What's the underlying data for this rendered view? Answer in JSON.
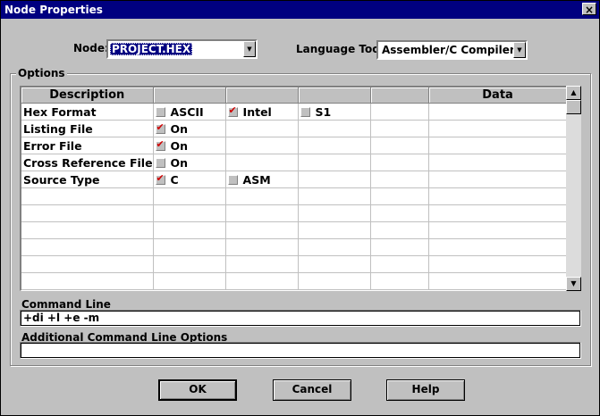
{
  "window": {
    "title": "Node Properties",
    "close_glyph": "×"
  },
  "node": {
    "label": "Node:",
    "value": "PROJECT.HEX"
  },
  "language_tool": {
    "label": "Language Tool:",
    "value": "Assembler/C Compiler"
  },
  "options": {
    "group_label": "Options",
    "headers": [
      "Description",
      "",
      "",
      "",
      "",
      "Data"
    ],
    "rows": [
      {
        "desc": "Hex Format",
        "c1": {
          "checked": false,
          "label": "ASCII"
        },
        "c2": {
          "checked": true,
          "label": "Intel"
        },
        "c3": {
          "checked": false,
          "label": "S1"
        }
      },
      {
        "desc": "Listing File",
        "c1": {
          "checked": true,
          "label": "On"
        }
      },
      {
        "desc": "Error File",
        "c1": {
          "checked": true,
          "label": "On"
        }
      },
      {
        "desc": "Cross Reference File",
        "c1": {
          "checked": false,
          "label": "On"
        }
      },
      {
        "desc": "Source Type",
        "c1": {
          "checked": true,
          "label": "C"
        },
        "c2": {
          "checked": false,
          "label": "ASM"
        }
      },
      {
        "desc": ""
      },
      {
        "desc": ""
      },
      {
        "desc": ""
      },
      {
        "desc": ""
      },
      {
        "desc": ""
      },
      {
        "desc": ""
      }
    ]
  },
  "command_line": {
    "label": "Command Line",
    "value": "+di +l +e -m"
  },
  "additional": {
    "label": "Additional Command Line Options",
    "value": ""
  },
  "buttons": {
    "ok": "OK",
    "cancel": "Cancel",
    "help": "Help"
  }
}
